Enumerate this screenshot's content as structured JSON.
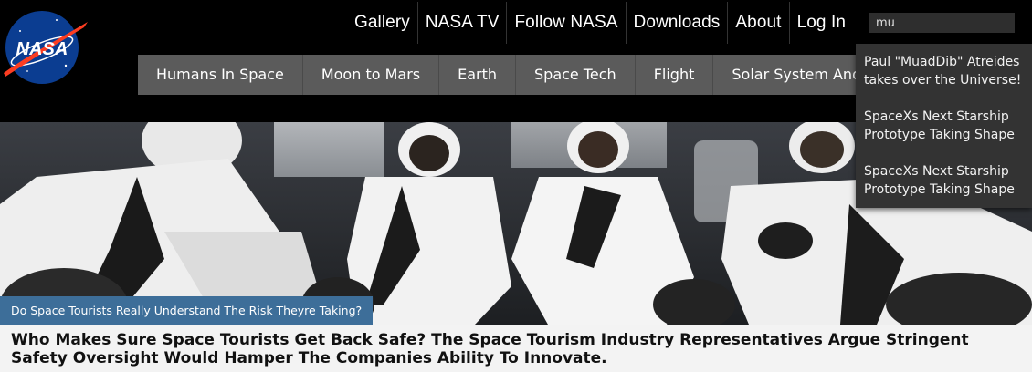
{
  "logo": {
    "text": "NASA"
  },
  "topnav": [
    "Gallery",
    "NASA TV",
    "Follow NASA",
    "Downloads",
    "About",
    "Log In"
  ],
  "search": {
    "value": "mu"
  },
  "mainnav": [
    "Humans In Space",
    "Moon to Mars",
    "Earth",
    "Space Tech",
    "Flight",
    "Solar System And Beyond"
  ],
  "suggestions": [
    "Paul \"MuadDib\" Atreides takes over the Universe!",
    "SpaceXs Next Starship Prototype Taking Shape",
    "SpaceXs Next Starship Prototype Taking Shape"
  ],
  "hero": {
    "caption": "Do Space Tourists Really Understand The Risk Theyre Taking?",
    "headline": "Who Makes Sure Space Tourists Get Back Safe? The Space Tourism Industry Representatives Argue Stringent Safety Oversight Would Hamper The Companies Ability To Innovate."
  },
  "colors": {
    "nav_bg": "#5b5b5b",
    "caption_bg": "#3d6e99",
    "suggest_bg": "#333333",
    "logo_blue": "#0b3d91",
    "logo_red": "#fc3d21"
  },
  "icons": {
    "logo": "nasa-meatball-logo"
  }
}
